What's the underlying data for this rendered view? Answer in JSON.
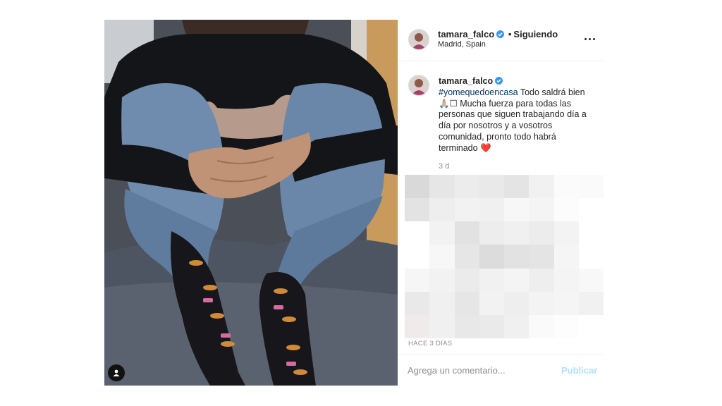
{
  "post": {
    "username": "tamara_falco",
    "verified": true,
    "follow_separator": "•",
    "follow_status": "Siguiendo",
    "location": "Madrid, Spain",
    "more_icon": "more-horizontal-icon",
    "user_tag_icon": "user-tag-icon"
  },
  "caption": {
    "username": "tamara_falco",
    "hashtag": "#yomequedoencasa",
    "body": " Todo saldrá bien 🙏🏼☐ Mucha fuerza para todas las personas que siguen trabajando día a día por nosotros y a vosotros comunidad, pronto todo habrá terminado ",
    "emoji": "❤️",
    "relative_time": "3 d"
  },
  "footer": {
    "timestamp": "HACE 3 DÍAS",
    "comment_placeholder": "Agrega un comentario...",
    "publish_label": "Publicar"
  },
  "colors": {
    "verified_blue": "#3897f0",
    "hashtag_blue": "#003569",
    "publish_disabled": "#b2dffc",
    "muted_text": "#8e8e8e"
  }
}
